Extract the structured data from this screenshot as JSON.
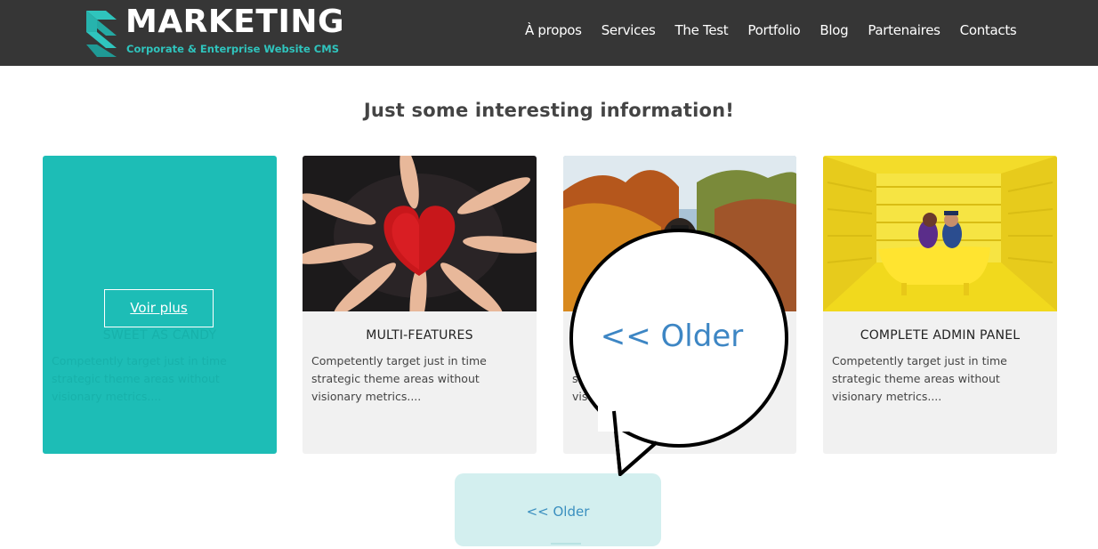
{
  "header": {
    "logo_title": "MARKETING",
    "logo_subtitle": "Corporate & Enterprise Website CMS",
    "nav": [
      "À propos",
      "Services",
      "The Test",
      "Portfolio",
      "Blog",
      "Partenaires",
      "Contacts"
    ]
  },
  "section": {
    "title": "Just some interesting information!"
  },
  "cards": [
    {
      "title": "SWEET AS CANDY",
      "text": "Competently target just in time strategic theme areas without visionary metrics....",
      "button": "Voir plus"
    },
    {
      "title": "MULTI-FEATURES",
      "text": "Competently target just in time strategic theme areas without visionary metrics...."
    },
    {
      "title": "",
      "text": "Competently target just in time strategic theme areas without visionary metrics...."
    },
    {
      "title": "COMPLETE ADMIN PANEL",
      "text": "Competently target just in time strategic theme areas without visionary metrics...."
    }
  ],
  "pagination": {
    "older_label": "<< Older"
  },
  "callout": {
    "label": "<< Older"
  },
  "colors": {
    "header_bg": "#363636",
    "accent": "#1dbdb6",
    "link": "#3a8fbf",
    "card_bg": "#f1f1f1"
  }
}
